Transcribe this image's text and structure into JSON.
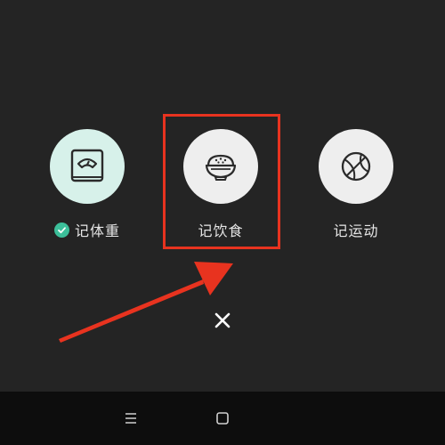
{
  "actions": [
    {
      "label": "记体重",
      "icon": "scale-icon",
      "checked": true,
      "circle_color": "#d7f1ea"
    },
    {
      "label": "记饮食",
      "icon": "rice-bowl-icon",
      "checked": false,
      "circle_color": "#eeeeee"
    },
    {
      "label": "记运动",
      "icon": "basketball-icon",
      "checked": false,
      "circle_color": "#eeeeee"
    }
  ],
  "close": {
    "icon": "close-icon"
  },
  "navbar": {
    "items": [
      "menu-icon",
      "home-icon"
    ]
  },
  "colors": {
    "background": "#242424",
    "highlight": "#e8331f",
    "check": "#3cbf9a",
    "label_text": "#e6e6e6",
    "navbar": "#0d0d0d"
  }
}
